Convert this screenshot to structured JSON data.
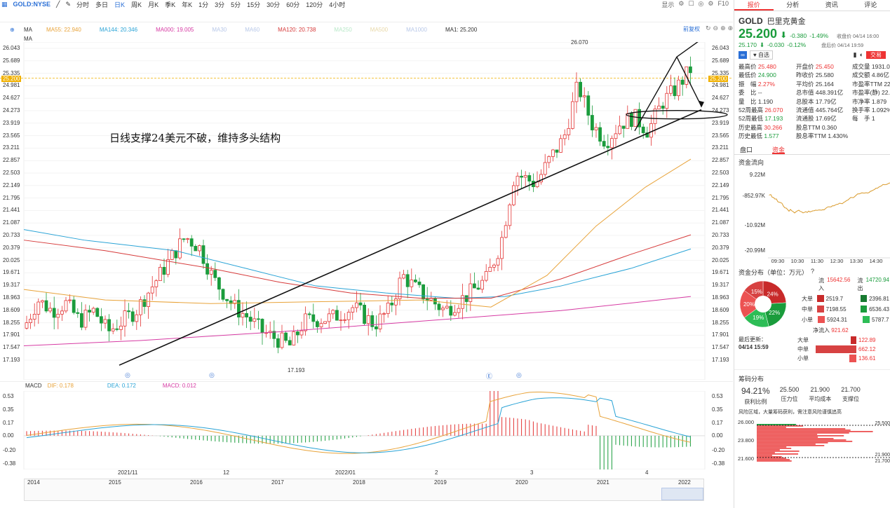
{
  "toolbar": {
    "symbol": "GOLD:NYSE",
    "periods": [
      "分时",
      "多日",
      "日K",
      "周K",
      "月K",
      "季K",
      "年K",
      "1分",
      "3分",
      "5分",
      "15分",
      "30分",
      "60分",
      "120分",
      "4小时"
    ],
    "active_period": "日K",
    "right": [
      "显示",
      "F10"
    ]
  },
  "ma_legend": {
    "row1": [
      {
        "label": "MA",
        "color": "#333333"
      },
      {
        "label": "MA55: 22.940",
        "color": "#e8a33a"
      },
      {
        "label": "MA144: 20.346",
        "color": "#29a3d6"
      },
      {
        "label": "MA000: 19.005",
        "color": "#d63aa3"
      },
      {
        "label": "MA30",
        "color": "#b8c8e8"
      },
      {
        "label": "MA60",
        "color": "#b8c8e8"
      },
      {
        "label": "MA120: 20.738",
        "color": "#d63a3a"
      },
      {
        "label": "MA250",
        "color": "#b8e8c8"
      },
      {
        "label": "MA500",
        "color": "#e8d8a8"
      },
      {
        "label": "MA1000",
        "color": "#b8c8e8"
      },
      {
        "label": "MA1: 25.200",
        "color": "#333333"
      }
    ],
    "row2_label": "MA",
    "adjust": "前复权"
  },
  "price_axis": [
    "26.043",
    "25.689",
    "25.335",
    "24.981",
    "24.627",
    "24.273",
    "23.919",
    "23.565",
    "23.211",
    "22.857",
    "22.503",
    "22.149",
    "21.795",
    "21.441",
    "21.087",
    "20.733",
    "20.379",
    "20.025",
    "19.671",
    "19.317",
    "18.963",
    "18.609",
    "18.255",
    "17.901",
    "17.547",
    "17.193"
  ],
  "price_axis_right": [
    "26.043",
    "25.689",
    "25.335",
    "24.981",
    "24.627",
    "24.273",
    "23.919",
    "23.565",
    "23.211",
    "22.857",
    "22.503",
    "22.149",
    "21.795",
    "21.441",
    "21.087",
    "20.733",
    "20.379",
    "20.025",
    "19.671",
    "19.317",
    "18.963",
    "18.609",
    "18.255",
    "17.901",
    "17.547",
    "17.193"
  ],
  "current_price_tag": "25.200",
  "high_label": "26.070",
  "low_label": "17.193",
  "annotation_text": "日线支撑24美元不破，维持多头结构",
  "macd": {
    "label": "MACD",
    "dif": "DIF: 0.178",
    "dea": "DEA: 0.172",
    "macd": "MACD: 0.012",
    "axis": [
      "0.53",
      "0.35",
      "0.17",
      "0.00",
      "-0.20",
      "-0.38"
    ]
  },
  "time_axis": [
    "2021/11",
    "12",
    "2022/01",
    "2",
    "3",
    "4"
  ],
  "year_axis": [
    "2014",
    "2015",
    "2016",
    "2017",
    "2018",
    "2019",
    "2020",
    "2021",
    "2022"
  ],
  "quote": {
    "tabs": [
      "报价",
      "分析",
      "资讯",
      "评论"
    ],
    "code": "GOLD",
    "name": "巴里克黄金",
    "price": "25.200",
    "change": "-0.380",
    "pct": "-1.49%",
    "close_label": "收盘价 04/14 16:00",
    "after_price": "25.170",
    "after_change": "-0.030",
    "after_pct": "-0.12%",
    "after_label": "盘后价 04/14 19:59",
    "watch_btn": "自选",
    "trade_btn": "交易",
    "rows": [
      [
        "最高价",
        "25.480",
        "开盘价",
        "25.450",
        "成交量",
        "1931.0"
      ],
      [
        "最低价",
        "24.900",
        "昨收价",
        "25.580",
        "成交额",
        "4.86亿"
      ],
      [
        "振　幅",
        "2.27%",
        "平均价",
        "25.164",
        "市盈率TTM",
        "22.0"
      ],
      [
        "委　比",
        "--",
        "总市值",
        "448.391亿",
        "市盈率(静)",
        "22.1"
      ],
      [
        "量　比",
        "1.190",
        "总股本",
        "17.79亿",
        "市净率",
        "1.879"
      ],
      [
        "52周最高",
        "26.070",
        "流通值",
        "445.764亿",
        "换手率",
        "1.092%"
      ],
      [
        "52周最低",
        "17.193",
        "流通股",
        "17.69亿",
        "每　手",
        "1"
      ],
      [
        "历史最高",
        "30.266",
        "股息TTM",
        "0.360",
        "",
        ""
      ],
      [
        "历史最低",
        "1.577",
        "股息率TTM",
        "1.430%",
        "",
        ""
      ]
    ],
    "sub_tabs": [
      "盘口",
      "资金"
    ],
    "flow_title": "资金流向",
    "flow_axis": [
      "9.22M",
      "-852.97K",
      "-10.92M",
      "-20.99M"
    ],
    "flow_time": [
      "09:30",
      "10:30",
      "11:30",
      "12:30",
      "13:30",
      "14:30",
      "16"
    ],
    "dist_title": "资金分布（单位：万元）",
    "in_label": "流入",
    "in_total": "15642.56",
    "out_label": "流出",
    "out_total": "14720.94",
    "pie": [
      {
        "label": "24%",
        "color": "#c82a2a",
        "value": 24
      },
      {
        "label": "22%",
        "color": "#1a9c3c",
        "value": 22
      },
      {
        "label": "19%",
        "color": "#2dbd56",
        "value": 19
      },
      {
        "label": "20%",
        "color": "#ec5252",
        "value": 20
      },
      {
        "label": "15%",
        "color": "#d74242",
        "value": 15
      }
    ],
    "dist_rows": [
      {
        "name": "大单",
        "in": "2519.7",
        "out": "2396.81"
      },
      {
        "name": "中单",
        "in": "7198.55",
        "out": "6536.43"
      },
      {
        "name": "小单",
        "in": "5924.31",
        "out": "5787.7"
      }
    ],
    "update_label": "最后更新：",
    "update_time": "04/14 15:59",
    "net_label": "净流入",
    "net_total": "921.62",
    "net_rows": [
      {
        "name": "大单",
        "value": "122.89"
      },
      {
        "name": "中单",
        "value": "662.12"
      },
      {
        "name": "小单",
        "value": "136.61"
      }
    ],
    "chip_title": "筹码分布",
    "chip_stats": [
      {
        "value": "94.21%",
        "label": "获利比例"
      },
      {
        "value": "25.500",
        "label": "压力位"
      },
      {
        "value": "21.900",
        "label": "平均成本"
      },
      {
        "value": "21.700",
        "label": "支撑位"
      }
    ],
    "chip_note": "风险区域，大量筹码获利，需注意风险谨慎追高",
    "chip_axis": [
      "26.000",
      "23.800",
      "21.600"
    ],
    "chip_tags": [
      "25.500",
      "21.900",
      "21.700"
    ]
  },
  "colors": {
    "up": "#e33333",
    "down": "#1a9c3c",
    "accent": "#2a6fd6"
  }
}
